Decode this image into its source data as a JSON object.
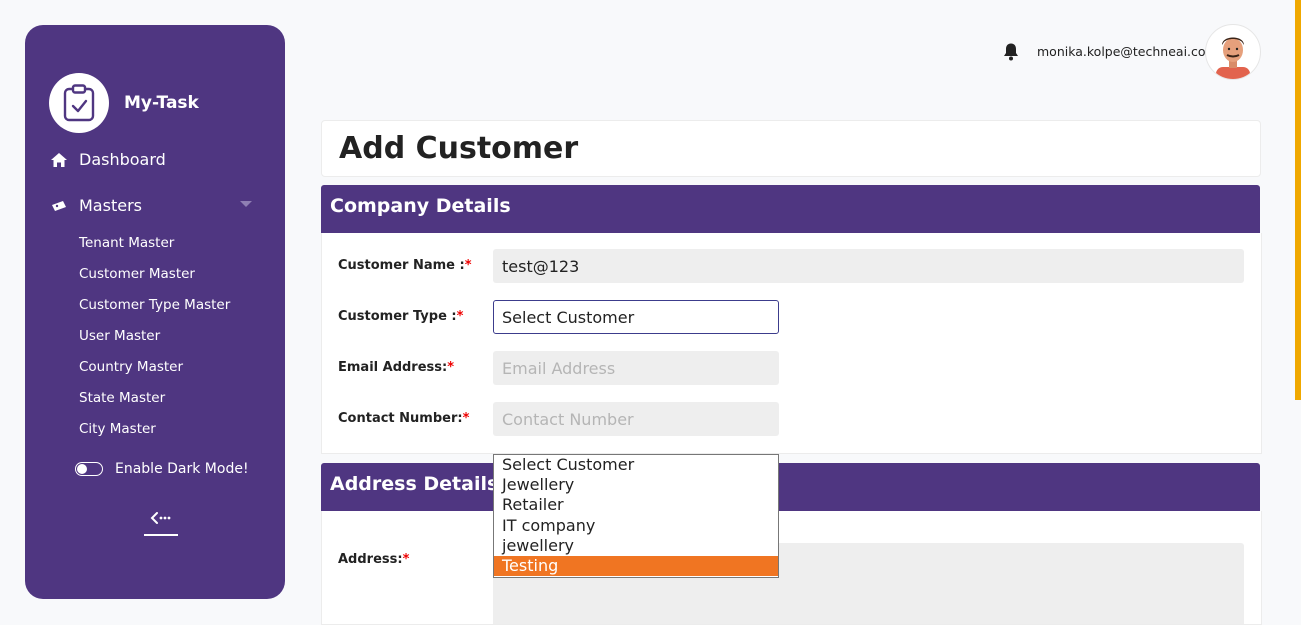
{
  "sidebar": {
    "brand": "My-Task",
    "nav": [
      {
        "label": "Dashboard",
        "icon": "home-icon"
      },
      {
        "label": "Masters",
        "icon": "ticket-icon"
      }
    ],
    "masters": [
      "Tenant Master",
      "Customer Master",
      "Customer Type Master",
      "User Master",
      "Country Master",
      "State Master",
      "City Master"
    ],
    "dark_mode_label": "Enable Dark Mode!"
  },
  "header": {
    "user_email": "monika.kolpe@techneai.com"
  },
  "page": {
    "title": "Add Customer"
  },
  "company": {
    "heading": "Company Details",
    "customer_name_label": "Customer Name :",
    "customer_name_value": "test@123",
    "customer_type_label": "Customer Type :",
    "customer_type_value": "Select Customer",
    "email_label": "Email Address:",
    "email_placeholder": "Email Address",
    "contact_label": "Contact Number:",
    "contact_placeholder": "Contact Number",
    "required_mark": "*"
  },
  "address": {
    "heading": "Address Details",
    "address_label": "Address:"
  },
  "dropdown": {
    "options": [
      "Select Customer",
      "Jewellery",
      "Retailer",
      "IT company",
      "jewellery",
      "Testing"
    ],
    "highlighted": "Testing"
  },
  "colors": {
    "primary": "#4f3681",
    "highlight": "#f07522",
    "required": "#e00000"
  }
}
